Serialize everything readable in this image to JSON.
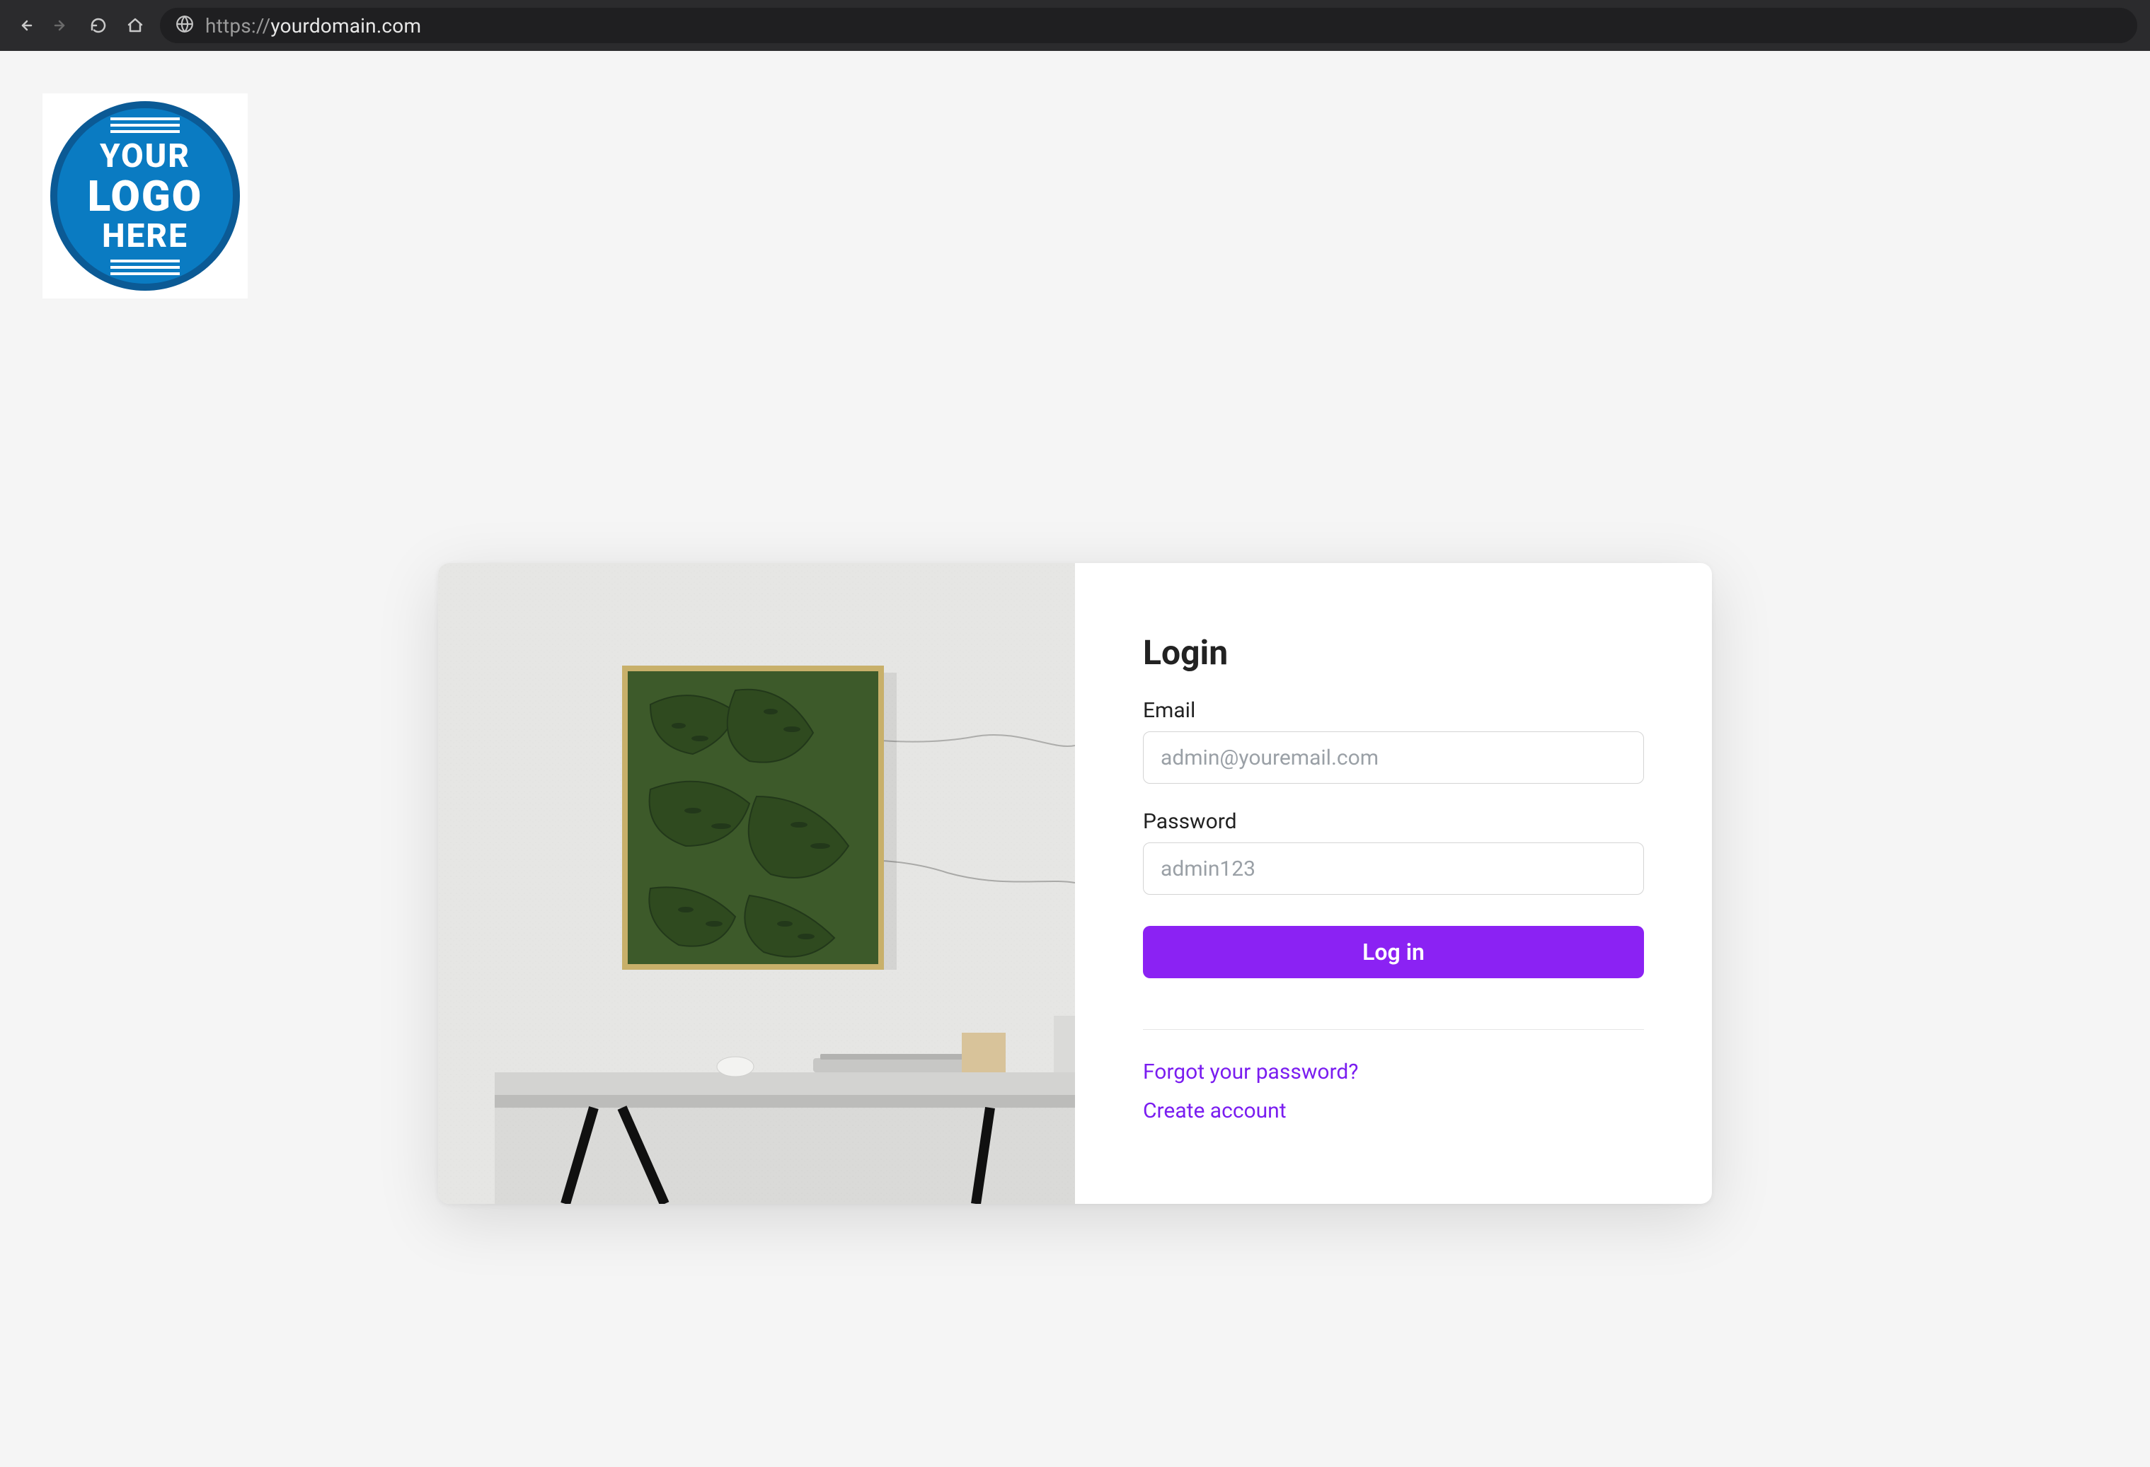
{
  "browser": {
    "url_prefix": "https://",
    "url_host": "yourdomain.com",
    "icons": {
      "back": "back-icon",
      "forward": "forward-icon",
      "reload": "reload-icon",
      "home": "home-icon",
      "globe": "globe-icon"
    }
  },
  "logo": {
    "line1": "YOUR",
    "line2": "LOGO",
    "line3": "HERE"
  },
  "login": {
    "title": "Login",
    "email_label": "Email",
    "email_placeholder": "admin@youremail.com",
    "password_label": "Password",
    "password_placeholder": "admin123",
    "submit_label": "Log in",
    "forgot_label": "Forgot your password?",
    "create_label": "Create account"
  },
  "colors": {
    "accent": "#8b22f3",
    "link": "#7a1df0"
  }
}
